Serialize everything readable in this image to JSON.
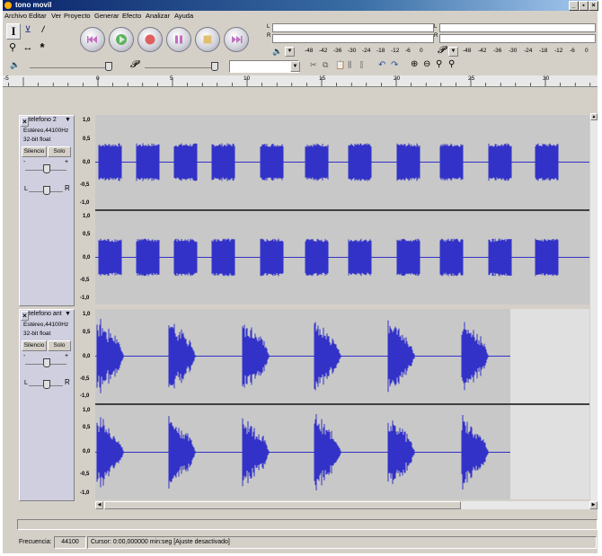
{
  "window": {
    "title": "tono movil"
  },
  "menu": [
    "Archivo",
    "Editar",
    "Ver",
    "Proyecto",
    "Generar",
    "Efecto",
    "Analizar",
    "Ayuda"
  ],
  "window_buttons": [
    "_",
    "×"
  ],
  "meters": {
    "scale": [
      "-48",
      "-42",
      "-36",
      "-30",
      "-24",
      "-18",
      "-12",
      "-6",
      "0"
    ],
    "left_channel": "L",
    "right_channel": "R"
  },
  "ruler": {
    "labels": [
      "-5",
      "0",
      "5",
      "10",
      "15",
      "20",
      "25",
      "30"
    ]
  },
  "tracks": [
    {
      "name": "telefono 2",
      "format": "Estéreo,44100Hz",
      "bits": "32-bit float",
      "mute_label": "Silencio",
      "solo_label": "Solo",
      "gain_minus": "-",
      "gain_plus": "+",
      "pan_left": "L",
      "pan_right": "R",
      "scale": [
        "1,0",
        "0,5",
        "0,0",
        "-0,5",
        "-1,0"
      ]
    },
    {
      "name": "telefono ant",
      "format": "Estéreo,44100Hz",
      "bits": "32-bit float",
      "mute_label": "Silencio",
      "solo_label": "Solo",
      "gain_minus": "-",
      "gain_plus": "+",
      "pan_left": "L",
      "pan_right": "R",
      "scale": [
        "1,0",
        "0,5",
        "0,0",
        "-0,5",
        "-1,0"
      ]
    }
  ],
  "status": {
    "freq_label": "Frecuencia:",
    "freq_value": "44100",
    "cursor_text": "Cursor: 0:00,000000 min:seg  [Ajuste desactivado]"
  },
  "colors": {
    "waveform": "#3232c8",
    "track_bg": "#c8c8c8",
    "panel_bg": "#cfcfe0"
  }
}
